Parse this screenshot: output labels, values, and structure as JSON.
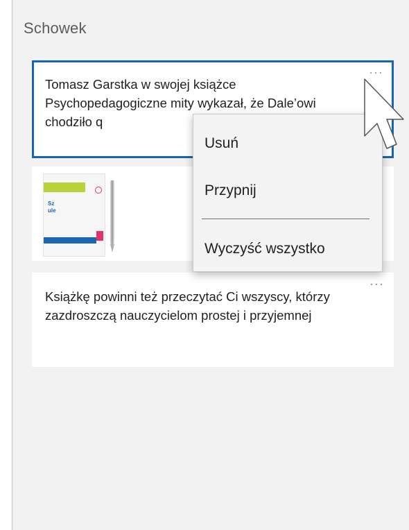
{
  "panel": {
    "title": "Schowek"
  },
  "clips": [
    {
      "text": "Tomasz Garstka w swojej książce Psychopedagogiczne mity wykazał, że Dale’owi chodziło q",
      "more_label": "···"
    },
    {
      "image": "book-and-pen-thumbnail",
      "more_label": ""
    },
    {
      "text": "Książkę powinni też przeczytać Ci wszyscy, którzy zazdroszczą nauczycielom prostej i przyjemnej",
      "more_label": "···"
    }
  ],
  "context_menu": {
    "items": [
      "Usuń",
      "Przypnij",
      "Wyczyść wszystko"
    ]
  },
  "colors": {
    "accent": "#1565b8",
    "background": "#f2f2f2",
    "card": "#ffffff"
  },
  "icons": {
    "more": "more-horizontal-icon",
    "cursor": "mouse-pointer-icon"
  }
}
